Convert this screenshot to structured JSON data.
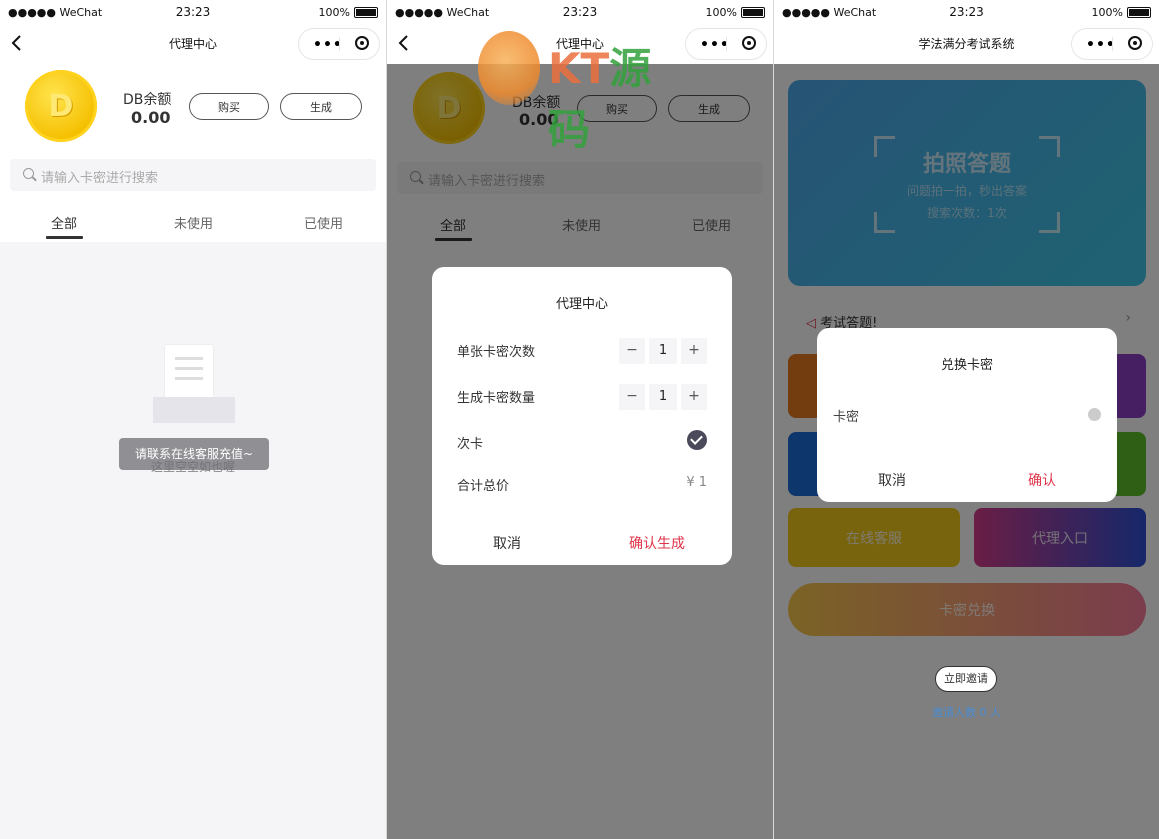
{
  "status_bar": {
    "carrier": "●●●●● WeChat",
    "time": "23:23",
    "battery": "100%"
  },
  "screen1": {
    "nav_title": "代理中心",
    "coin_letter": "D",
    "balance_label": "DB余额",
    "balance_value": "0.00",
    "buy_label": "购买",
    "generate_label": "生成",
    "search_placeholder": "请输入卡密进行搜索",
    "tabs": [
      "全部",
      "未使用",
      "已使用"
    ],
    "toast": "请联系在线客服充值~",
    "empty_text": "这里空空如也喔"
  },
  "screen2": {
    "nav_title": "代理中心",
    "balance_label": "DB余额",
    "balance_value": "0.00",
    "buy_label": "购买",
    "generate_label": "生成",
    "search_placeholder": "请输入卡密进行搜索",
    "tabs": [
      "全部",
      "未使用",
      "已使用"
    ],
    "modal": {
      "title": "代理中心",
      "row1_label": "单张卡密次数",
      "row1_value": "1",
      "row2_label": "生成卡密数量",
      "row2_value": "1",
      "row3_label": "次卡",
      "row4_label": "合计总价",
      "row4_value": "¥ 1",
      "cancel": "取消",
      "confirm": "确认生成",
      "minus": "−",
      "plus": "+"
    }
  },
  "screen3": {
    "nav_title": "学法满分考试系统",
    "banner_title": "拍照答题",
    "banner_sub": "问题拍一拍，秒出答案",
    "banner_count": "搜索次数：1次",
    "notice": "考试答题!",
    "tile_service": "在线客服",
    "tile_agent": "代理入口",
    "tile_card": "卡密兑换",
    "invite_button": "立即邀请",
    "invite_count": "邀请人数 0 人",
    "modal": {
      "title": "兑换卡密",
      "field_label": "卡密",
      "cancel": "取消",
      "confirm": "确认"
    }
  },
  "watermark": {
    "brand": "KT",
    "word": "源码"
  },
  "colors": {
    "accent_red": "#e0344a",
    "dark": "#4a4a5a",
    "overlay": "rgba(0,0,0,0.5)"
  }
}
